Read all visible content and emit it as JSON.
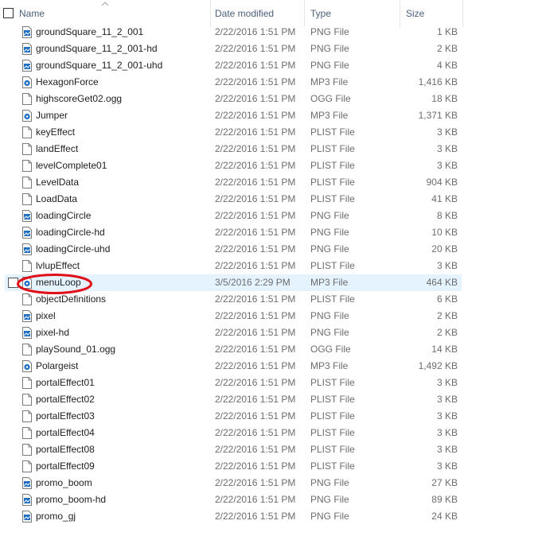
{
  "header": {
    "name": "Name",
    "date_modified": "Date modified",
    "type": "Type",
    "size": "Size"
  },
  "files": [
    {
      "name": "groundSquare_11_2_001",
      "date": "2/22/2016 1:51 PM",
      "type": "PNG File",
      "size": "1 KB",
      "icon": "image-file-icon"
    },
    {
      "name": "groundSquare_11_2_001-hd",
      "date": "2/22/2016 1:51 PM",
      "type": "PNG File",
      "size": "2 KB",
      "icon": "image-file-icon"
    },
    {
      "name": "groundSquare_11_2_001-uhd",
      "date": "2/22/2016 1:51 PM",
      "type": "PNG File",
      "size": "4 KB",
      "icon": "image-file-icon"
    },
    {
      "name": "HexagonForce",
      "date": "2/22/2016 1:51 PM",
      "type": "MP3 File",
      "size": "1,416 KB",
      "icon": "audio-file-icon"
    },
    {
      "name": "highscoreGet02.ogg",
      "date": "2/22/2016 1:51 PM",
      "type": "OGG File",
      "size": "18 KB",
      "icon": "blank-file-icon"
    },
    {
      "name": "Jumper",
      "date": "2/22/2016 1:51 PM",
      "type": "MP3 File",
      "size": "1,371 KB",
      "icon": "audio-file-icon"
    },
    {
      "name": "keyEffect",
      "date": "2/22/2016 1:51 PM",
      "type": "PLIST File",
      "size": "3 KB",
      "icon": "blank-file-icon"
    },
    {
      "name": "landEffect",
      "date": "2/22/2016 1:51 PM",
      "type": "PLIST File",
      "size": "3 KB",
      "icon": "blank-file-icon"
    },
    {
      "name": "levelComplete01",
      "date": "2/22/2016 1:51 PM",
      "type": "PLIST File",
      "size": "3 KB",
      "icon": "blank-file-icon"
    },
    {
      "name": "LevelData",
      "date": "2/22/2016 1:51 PM",
      "type": "PLIST File",
      "size": "904 KB",
      "icon": "blank-file-icon"
    },
    {
      "name": "LoadData",
      "date": "2/22/2016 1:51 PM",
      "type": "PLIST File",
      "size": "41 KB",
      "icon": "blank-file-icon"
    },
    {
      "name": "loadingCircle",
      "date": "2/22/2016 1:51 PM",
      "type": "PNG File",
      "size": "8 KB",
      "icon": "image-file-icon"
    },
    {
      "name": "loadingCircle-hd",
      "date": "2/22/2016 1:51 PM",
      "type": "PNG File",
      "size": "10 KB",
      "icon": "image-file-icon"
    },
    {
      "name": "loadingCircle-uhd",
      "date": "2/22/2016 1:51 PM",
      "type": "PNG File",
      "size": "20 KB",
      "icon": "image-file-icon"
    },
    {
      "name": "lvlupEffect",
      "date": "2/22/2016 1:51 PM",
      "type": "PLIST File",
      "size": "3 KB",
      "icon": "blank-file-icon"
    },
    {
      "name": "menuLoop",
      "date": "3/5/2016 2:29 PM",
      "type": "MP3 File",
      "size": "464 KB",
      "icon": "audio-file-icon",
      "selected": true
    },
    {
      "name": "objectDefinitions",
      "date": "2/22/2016 1:51 PM",
      "type": "PLIST File",
      "size": "6 KB",
      "icon": "blank-file-icon"
    },
    {
      "name": "pixel",
      "date": "2/22/2016 1:51 PM",
      "type": "PNG File",
      "size": "2 KB",
      "icon": "image-file-icon"
    },
    {
      "name": "pixel-hd",
      "date": "2/22/2016 1:51 PM",
      "type": "PNG File",
      "size": "2 KB",
      "icon": "image-file-icon"
    },
    {
      "name": "playSound_01.ogg",
      "date": "2/22/2016 1:51 PM",
      "type": "OGG File",
      "size": "14 KB",
      "icon": "blank-file-icon"
    },
    {
      "name": "Polargeist",
      "date": "2/22/2016 1:51 PM",
      "type": "MP3 File",
      "size": "1,492 KB",
      "icon": "audio-file-icon"
    },
    {
      "name": "portalEffect01",
      "date": "2/22/2016 1:51 PM",
      "type": "PLIST File",
      "size": "3 KB",
      "icon": "blank-file-icon"
    },
    {
      "name": "portalEffect02",
      "date": "2/22/2016 1:51 PM",
      "type": "PLIST File",
      "size": "3 KB",
      "icon": "blank-file-icon"
    },
    {
      "name": "portalEffect03",
      "date": "2/22/2016 1:51 PM",
      "type": "PLIST File",
      "size": "3 KB",
      "icon": "blank-file-icon"
    },
    {
      "name": "portalEffect04",
      "date": "2/22/2016 1:51 PM",
      "type": "PLIST File",
      "size": "3 KB",
      "icon": "blank-file-icon"
    },
    {
      "name": "portalEffect08",
      "date": "2/22/2016 1:51 PM",
      "type": "PLIST File",
      "size": "3 KB",
      "icon": "blank-file-icon"
    },
    {
      "name": "portalEffect09",
      "date": "2/22/2016 1:51 PM",
      "type": "PLIST File",
      "size": "3 KB",
      "icon": "blank-file-icon"
    },
    {
      "name": "promo_boom",
      "date": "2/22/2016 1:51 PM",
      "type": "PNG File",
      "size": "27 KB",
      "icon": "image-file-icon"
    },
    {
      "name": "promo_boom-hd",
      "date": "2/22/2016 1:51 PM",
      "type": "PNG File",
      "size": "89 KB",
      "icon": "image-file-icon"
    },
    {
      "name": "promo_gj",
      "date": "2/22/2016 1:51 PM",
      "type": "PNG File",
      "size": "24 KB",
      "icon": "image-file-icon"
    }
  ],
  "annotation": {
    "color": "#e0101a"
  },
  "colors": {
    "selection": "#e5f3ff",
    "header_text": "#4c607a",
    "icon_blue": "#1e6fc4"
  }
}
